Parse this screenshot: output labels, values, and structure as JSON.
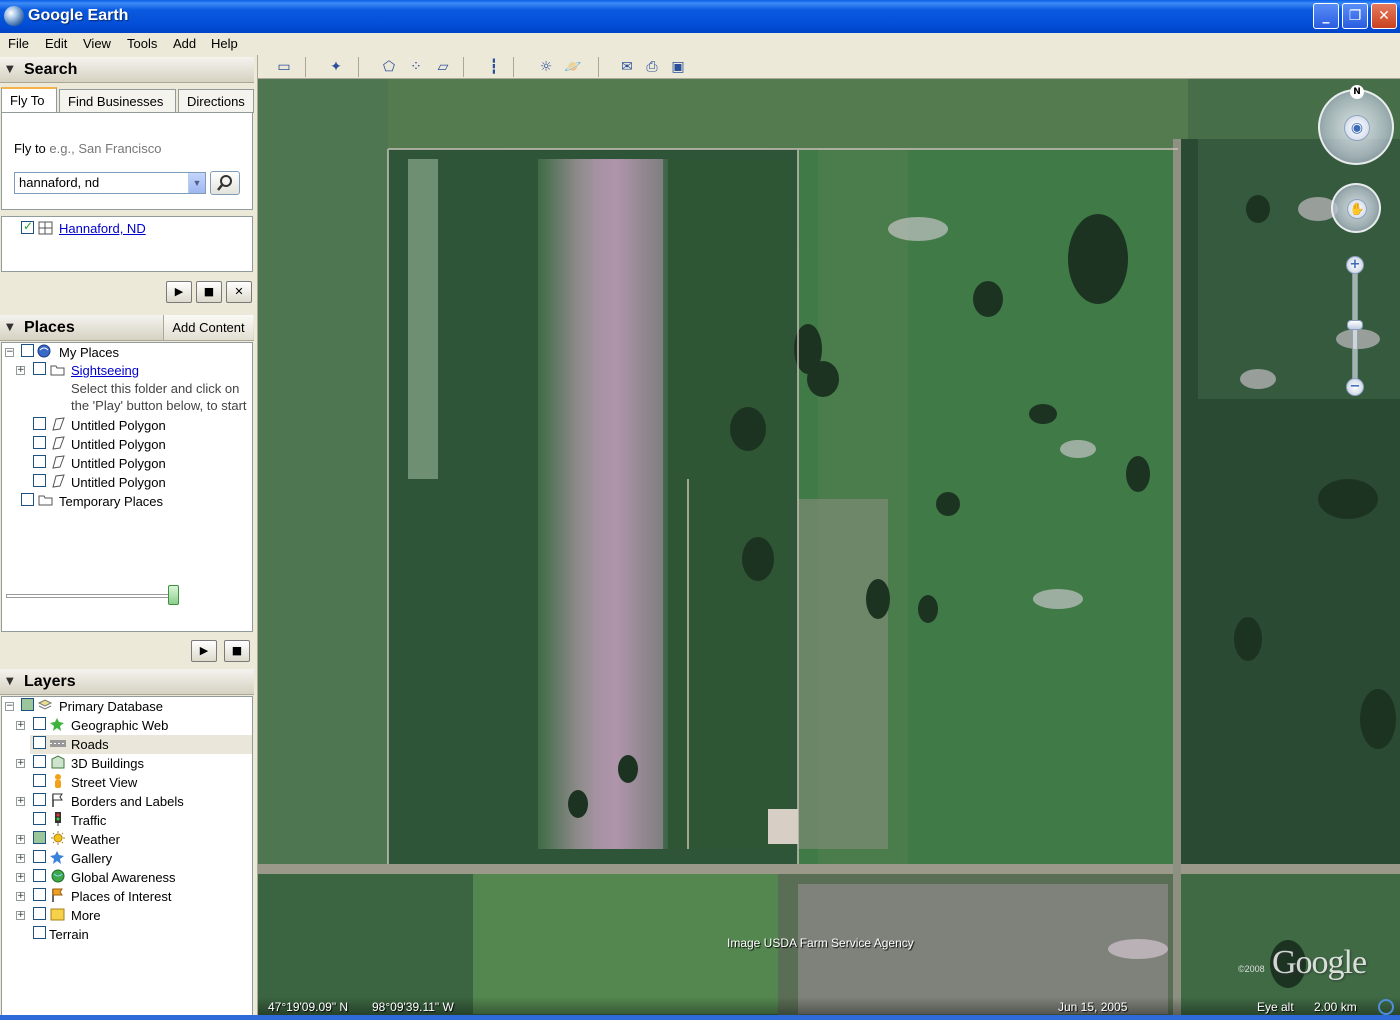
{
  "window": {
    "title": "Google Earth"
  },
  "menu": [
    "File",
    "Edit",
    "View",
    "Tools",
    "Add",
    "Help"
  ],
  "search": {
    "header": "Search",
    "tabs": [
      "Fly To",
      "Find Businesses",
      "Directions"
    ],
    "fly_to_label": "Fly to",
    "fly_to_placeholder": "e.g., San Francisco",
    "query_value": "hannaford, nd",
    "result": "Hannaford, ND"
  },
  "places": {
    "header": "Places",
    "add_content": "Add Content",
    "items": [
      {
        "label": "My Places"
      },
      {
        "label": "Sightseeing",
        "link": true
      },
      {
        "label": "Select this folder and click on"
      },
      {
        "label": "the 'Play' button below, to start"
      },
      {
        "label": "Untitled Polygon"
      },
      {
        "label": "Untitled Polygon"
      },
      {
        "label": "Untitled Polygon"
      },
      {
        "label": "Untitled Polygon"
      },
      {
        "label": "Temporary Places"
      }
    ]
  },
  "layers": {
    "header": "Layers",
    "items": [
      {
        "label": "Primary Database",
        "icon": "database-icon"
      },
      {
        "label": "Geographic Web",
        "icon": "star-icon"
      },
      {
        "label": "Roads",
        "icon": "road-icon"
      },
      {
        "label": "3D Buildings",
        "icon": "building-icon"
      },
      {
        "label": "Street View",
        "icon": "pegman-icon"
      },
      {
        "label": "Borders and Labels",
        "icon": "flag-icon"
      },
      {
        "label": "Traffic",
        "icon": "traffic-light-icon"
      },
      {
        "label": "Weather",
        "icon": "sun-icon"
      },
      {
        "label": "Gallery",
        "icon": "star-icon"
      },
      {
        "label": "Global Awareness",
        "icon": "globe-icon"
      },
      {
        "label": "Places of Interest",
        "icon": "flag-icon"
      },
      {
        "label": "More",
        "icon": "folder-icon"
      },
      {
        "label": "Terrain",
        "icon": ""
      }
    ]
  },
  "map": {
    "compass_north": "N",
    "credit": "Image USDA Farm Service Agency",
    "copyright": "©2008",
    "logo": "Google",
    "status": {
      "latitude": "47°19'09.09\" N",
      "longitude": "98°09'39.11\" W",
      "date": "Jun 15, 2005",
      "eye_alt_label": "Eye alt",
      "eye_alt_value": "2.00 km"
    }
  }
}
